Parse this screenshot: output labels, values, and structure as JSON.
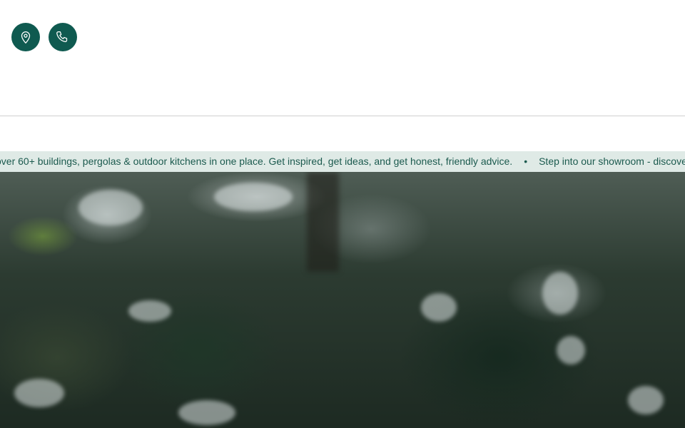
{
  "header": {
    "location_icon": "map-pin-icon",
    "phone_icon": "phone-icon",
    "icon_color": "#0f5a50"
  },
  "announcement": {
    "message_1": "over 60+ buildings, pergolas & outdoor kitchens in one place. Get inspired, get ideas, and get honest, friendly advice.",
    "separator": "•",
    "message_2": "Step into our showroom - discover",
    "background_color": "#dfeae6",
    "text_color": "#1b5a4e"
  },
  "hero": {
    "image_description_icon": "forest-background-image"
  }
}
